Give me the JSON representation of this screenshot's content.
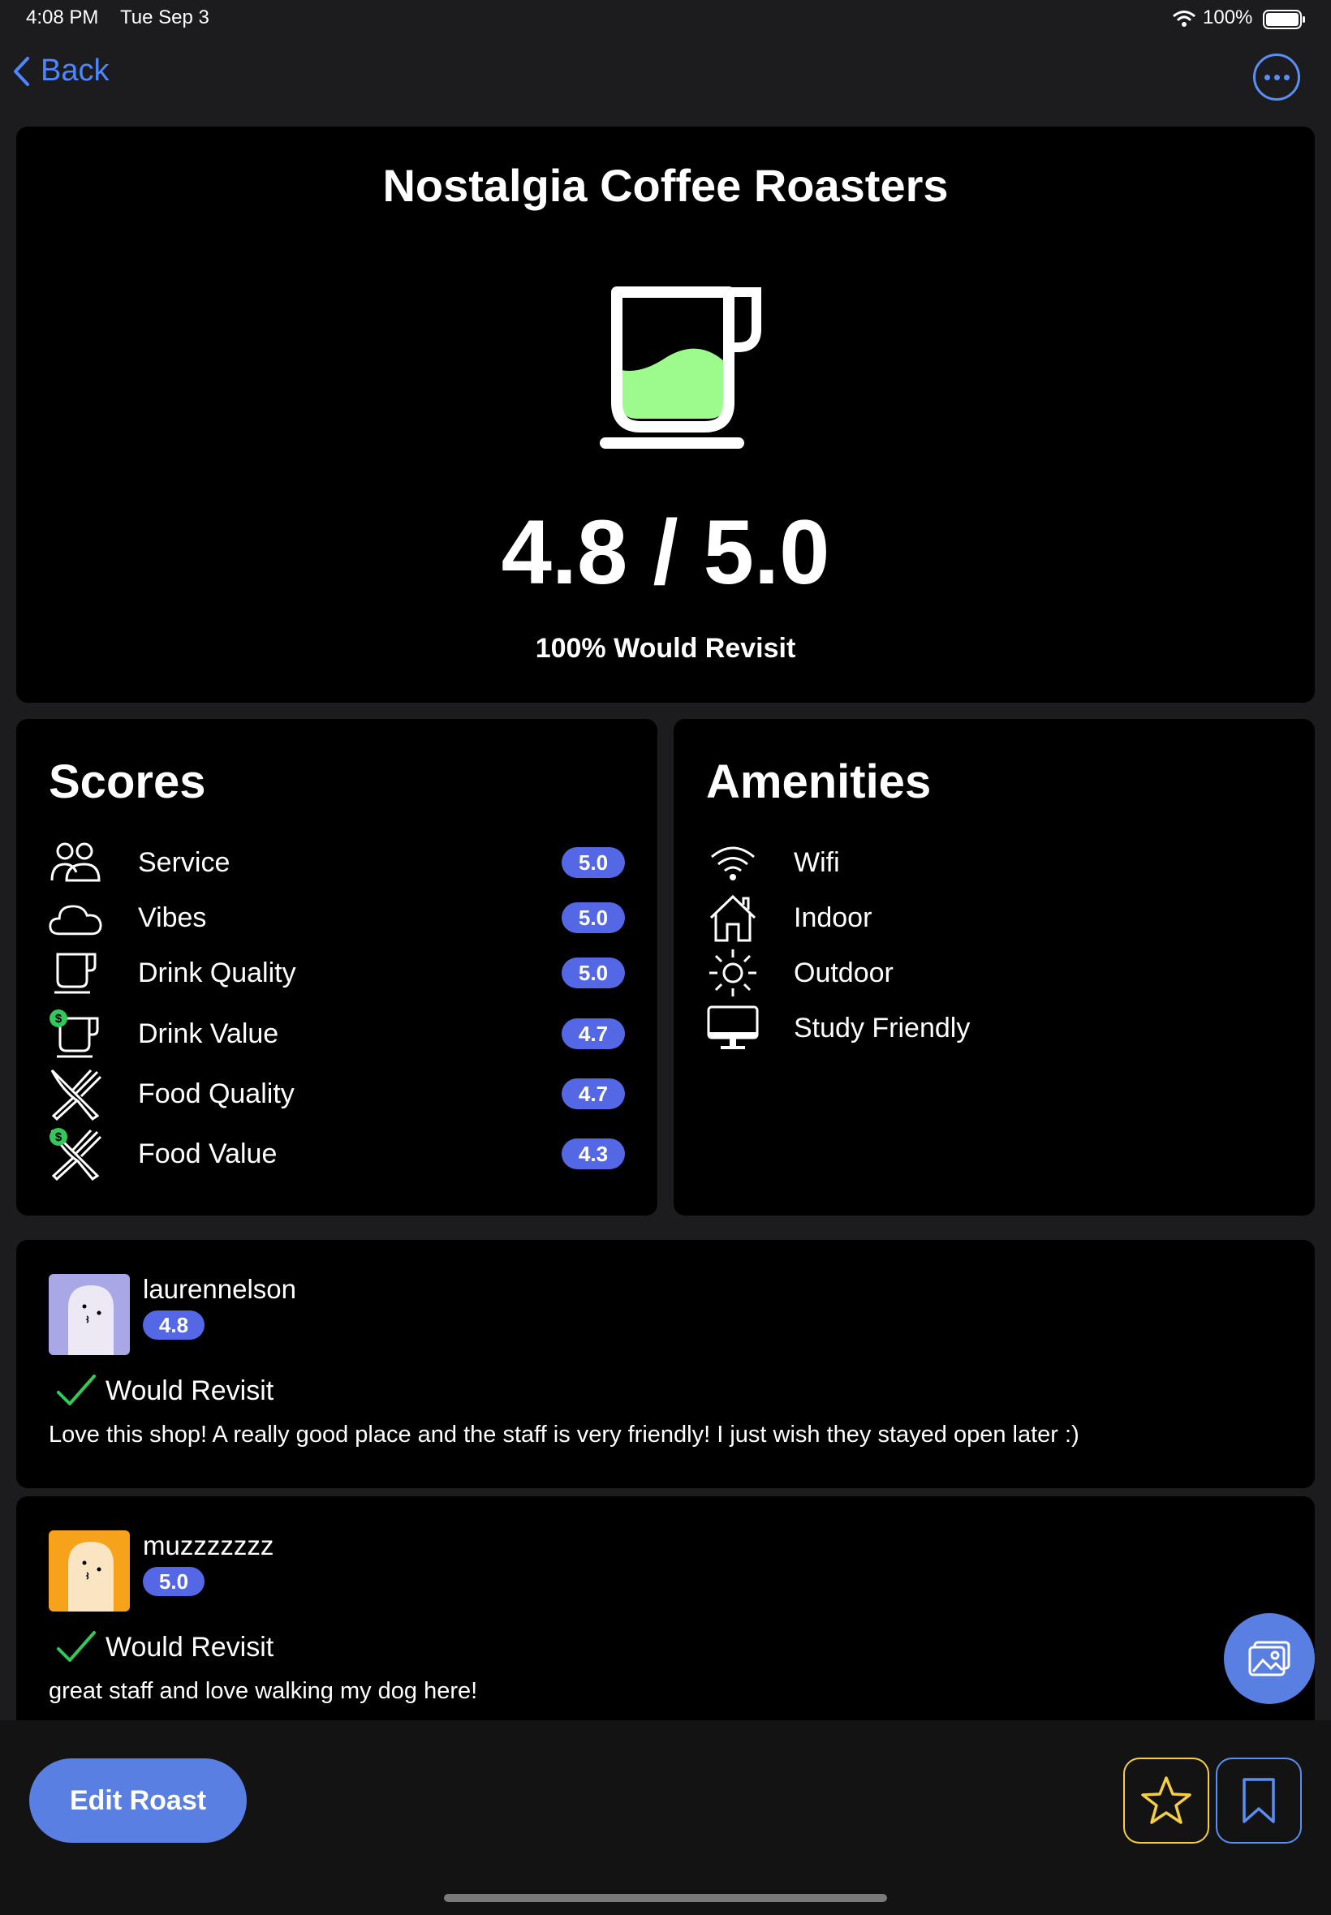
{
  "status": {
    "time": "4:08 PM",
    "date": "Tue Sep 3",
    "battery": "100%"
  },
  "nav": {
    "back_label": "Back"
  },
  "shop": {
    "name": "Nostalgia Coffee Roasters",
    "rating_text": "4.8 / 5.0",
    "revisit_text": "100% Would Revisit"
  },
  "scores": {
    "title": "Scores",
    "items": [
      {
        "label": "Service",
        "value": "5.0",
        "icon": "people-icon"
      },
      {
        "label": "Vibes",
        "value": "5.0",
        "icon": "cloud-icon"
      },
      {
        "label": "Drink Quality",
        "value": "5.0",
        "icon": "cup-icon"
      },
      {
        "label": "Drink Value",
        "value": "4.7",
        "icon": "cup-dollar-icon"
      },
      {
        "label": "Food Quality",
        "value": "4.7",
        "icon": "utensils-icon"
      },
      {
        "label": "Food Value",
        "value": "4.3",
        "icon": "utensils-dollar-icon"
      }
    ]
  },
  "amenities": {
    "title": "Amenities",
    "items": [
      {
        "label": "Wifi",
        "icon": "wifi-icon"
      },
      {
        "label": "Indoor",
        "icon": "house-icon"
      },
      {
        "label": "Outdoor",
        "icon": "sun-icon"
      },
      {
        "label": "Study Friendly",
        "icon": "monitor-icon"
      }
    ]
  },
  "reviews": [
    {
      "username": "laurennelson",
      "rating": "4.8",
      "revisit": "Would Revisit",
      "text": "Love this shop! A really good place and the staff is very friendly! I just wish they stayed open later :)",
      "avatar_color": "#a9a7e6"
    },
    {
      "username": "muzzzzzzz",
      "rating": "5.0",
      "revisit": "Would Revisit",
      "text": "great staff and love walking my dog here!",
      "avatar_color": "#f7a21b"
    }
  ],
  "actions": {
    "edit_label": "Edit Roast"
  },
  "colors": {
    "accent": "#5a7fe2",
    "pill": "#5468e6",
    "star": "#f4cf45",
    "check": "#34c759",
    "cup_fill": "#9dfb8e"
  }
}
